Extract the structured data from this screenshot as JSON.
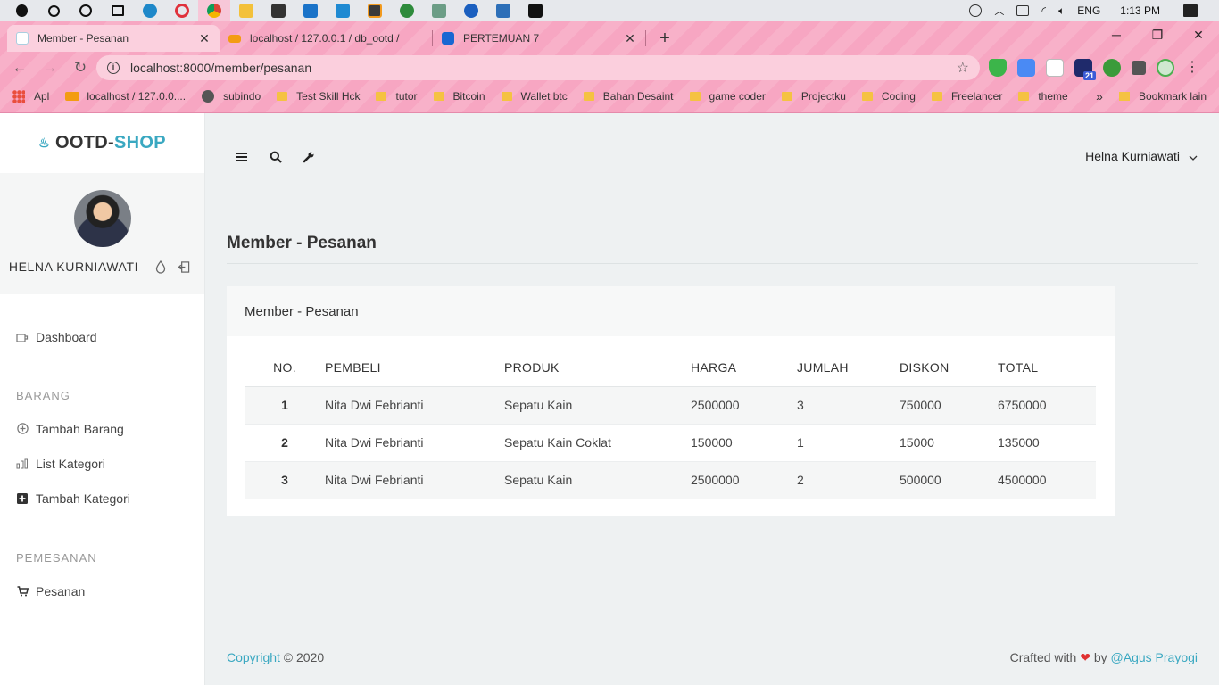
{
  "os": {
    "language": "ENG",
    "time": "1:13 PM"
  },
  "browser": {
    "tabs": [
      {
        "title": "Member - Pesanan",
        "active": true
      },
      {
        "title": "localhost / 127.0.0.1 / db_ootd / ",
        "active": false
      },
      {
        "title": "PERTEMUAN 7",
        "active": false
      }
    ],
    "close_glyph": "✕",
    "new_tab_glyph": "+",
    "url": "localhost:8000/member/pesanan",
    "bookmarks": [
      {
        "label": "Apl",
        "icon": "apps-icon"
      },
      {
        "label": "localhost / 127.0.0....",
        "icon": "pma-icon"
      },
      {
        "label": "subindo",
        "icon": "globe-icon"
      },
      {
        "label": "Test Skill Hck",
        "icon": "folder-icon"
      },
      {
        "label": "tutor",
        "icon": "folder-icon"
      },
      {
        "label": "Bitcoin",
        "icon": "folder-icon"
      },
      {
        "label": "Wallet btc",
        "icon": "folder-icon"
      },
      {
        "label": "Bahan Desaint",
        "icon": "folder-icon"
      },
      {
        "label": "game coder",
        "icon": "folder-icon"
      },
      {
        "label": "Projectku",
        "icon": "folder-icon"
      },
      {
        "label": "Coding",
        "icon": "folder-icon"
      },
      {
        "label": "Freelancer",
        "icon": "folder-icon"
      },
      {
        "label": "theme",
        "icon": "folder-icon"
      }
    ],
    "bookmarks_more": "»",
    "other_bookmarks": "Bookmark lain",
    "ext_badge": "21"
  },
  "sidebar": {
    "logo_part1": "OOTD-",
    "logo_part2": "SHOP",
    "profile_name": "HELNA KURNIAWATI",
    "menu": {
      "dashboard": "Dashboard",
      "barang_header": "BARANG",
      "tambah_barang": "Tambah Barang",
      "list_kategori": "List Kategori",
      "tambah_kategori": "Tambah Kategori",
      "pemesanan_header": "PEMESANAN",
      "pesanan": "Pesanan"
    }
  },
  "topbar": {
    "user_name": "Helna Kurniawati"
  },
  "page": {
    "title": "Member - Pesanan",
    "card_title": "Member - Pesanan"
  },
  "table": {
    "headers": [
      "NO.",
      "PEMBELI",
      "PRODUK",
      "HARGA",
      "JUMLAH",
      "DISKON",
      "TOTAL"
    ],
    "rows": [
      [
        "1",
        "Nita Dwi Febrianti",
        "Sepatu Kain",
        "2500000",
        "3",
        "750000",
        "6750000"
      ],
      [
        "2",
        "Nita Dwi Febrianti",
        "Sepatu Kain Coklat",
        "150000",
        "1",
        "15000",
        "135000"
      ],
      [
        "3",
        "Nita Dwi Febrianti",
        "Sepatu Kain",
        "2500000",
        "2",
        "500000",
        "4500000"
      ]
    ]
  },
  "footer": {
    "copyright_link": "Copyright",
    "copyright_rest": " © 2020",
    "crafted": "Crafted with",
    "heart": "❤",
    "by": " by ",
    "author": "@Agus Prayogi"
  },
  "colors": {
    "accent": "#3aa8c1",
    "chrome_pink": "#f7a6c2",
    "heart": "#e03131"
  }
}
